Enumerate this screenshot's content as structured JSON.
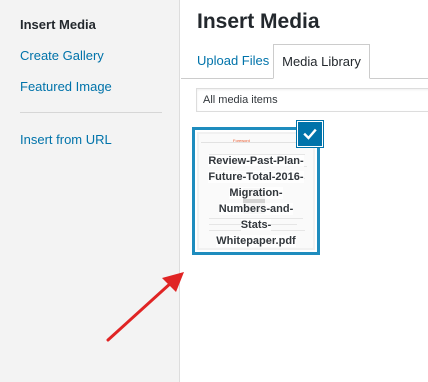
{
  "sidebar": {
    "items": [
      {
        "label": "Insert Media",
        "active": true
      },
      {
        "label": "Create Gallery",
        "active": false
      },
      {
        "label": "Featured Image",
        "active": false
      },
      {
        "label": "Insert from URL",
        "active": false
      }
    ]
  },
  "main": {
    "title": "Insert Media",
    "tabs": [
      {
        "label": "Upload Files",
        "active": false
      },
      {
        "label": "Media Library",
        "active": true
      }
    ],
    "filter": {
      "selected": "All media items"
    },
    "attachments": [
      {
        "filename": "Review-Past-Plan-Future-Total-2016-Migration-Numbers-and-Stats-Whitepaper.pdf",
        "filename_lines": [
          "Review-Past-Plan-",
          "Future-Total-2016-",
          "Migration-",
          "Numbers-and-",
          "Stats-",
          "Whitepaper.pdf"
        ],
        "thumbnail_word": "Foreword",
        "selected": true,
        "check_icon": "checkmark-icon"
      }
    ]
  },
  "annotation": {
    "type": "arrow",
    "color": "#e02424",
    "points_to": "attachment"
  },
  "colors": {
    "accent": "#0073aa",
    "selection_border": "#1e8cbe",
    "sidebar_bg": "#f3f3f3"
  }
}
